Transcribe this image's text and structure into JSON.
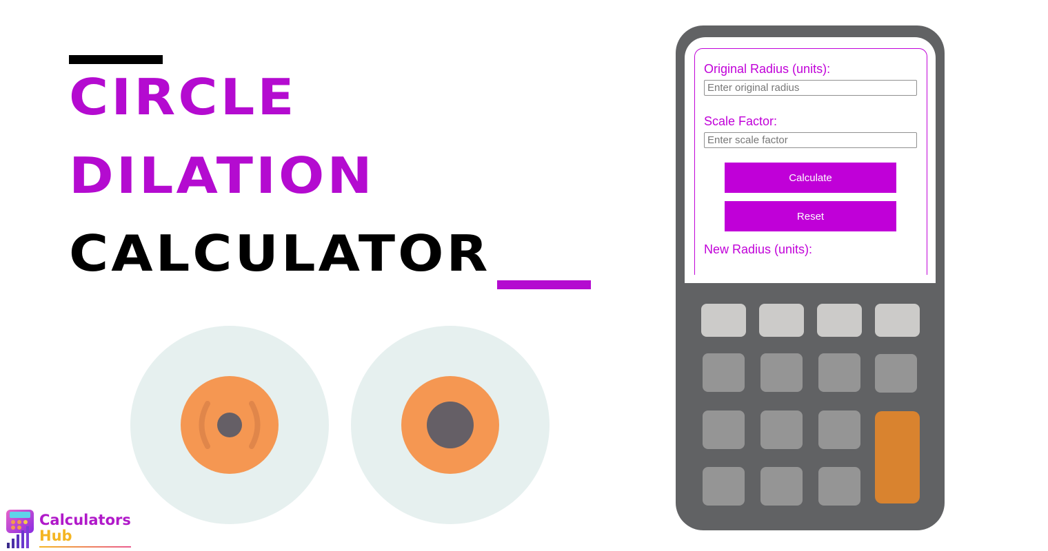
{
  "title": {
    "line1": "Circle",
    "line2": "Dilation",
    "line3": "Calculator"
  },
  "colors": {
    "accent": "#c000d8",
    "title_purple": "#b40bd0",
    "calc_body": "#616264",
    "iris": "#f59752",
    "pupil": "#655f66",
    "key_orange": "#d9832f"
  },
  "calculator": {
    "fields": [
      {
        "label": "Original Radius (units):",
        "value": "",
        "placeholder": "Enter original radius"
      },
      {
        "label": "Scale Factor:",
        "value": "",
        "placeholder": "Enter scale factor"
      }
    ],
    "buttons": {
      "calculate": "Calculate",
      "reset": "Reset"
    },
    "result_label": "New Radius (units):",
    "result_value": ""
  },
  "illustration": {
    "left_icon": "circle-with-radiating-arcs-icon",
    "right_icon": "dilated-circle-icon"
  },
  "logo": {
    "line1": "Calculators",
    "line2": "Hub",
    "icon": "calculator-bar-chart-icon"
  }
}
